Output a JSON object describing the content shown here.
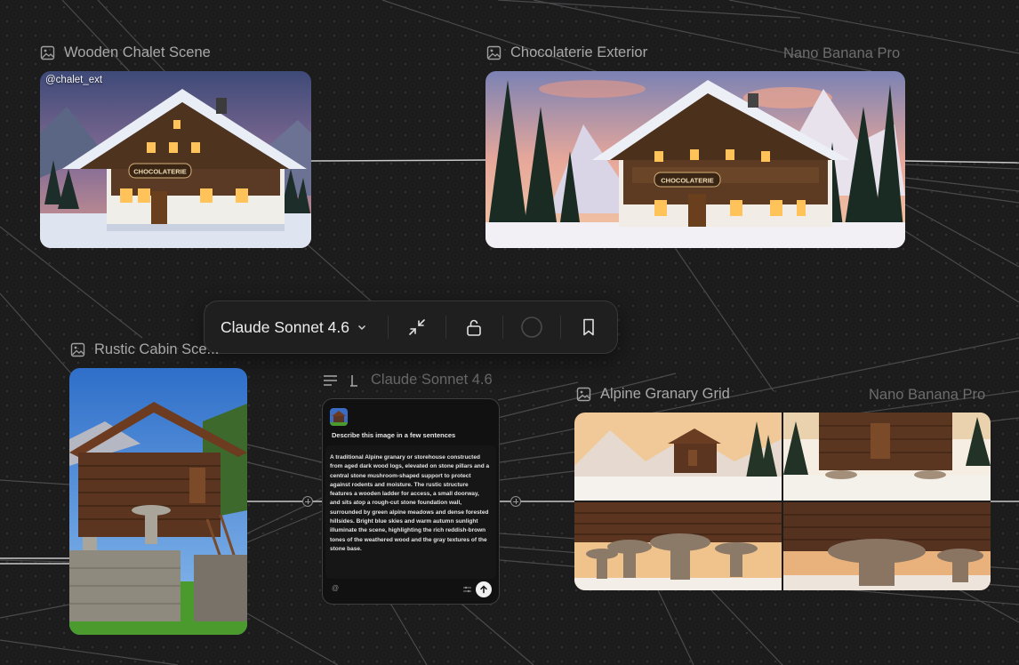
{
  "nodes": {
    "wooden_chalet": {
      "title": "Wooden Chalet Scene",
      "handle": "@chalet_ext"
    },
    "chocolaterie": {
      "title": "Chocolaterie Exterior",
      "model": "Nano Banana Pro"
    },
    "rustic_cabin": {
      "title": "Rustic Cabin Sce..."
    },
    "text_node": {
      "model": "Claude Sonnet 4.6",
      "prompt": "Describe this image in a few sentences",
      "response": "A traditional Alpine granary or storehouse constructed from aged dark wood logs, elevated on stone pillars and a central stone mushroom-shaped support to protect against rodents and moisture. The rustic structure features a wooden ladder for access, a small doorway, and sits atop a rough-cut stone foundation wall, surrounded by green alpine meadows and dense forested hillsides. Bright blue skies and warm autumn sunlight illuminate the scene, highlighting the rich reddish-brown tones of the weathered wood and the gray textures of the stone base.",
      "mention_symbol": "@"
    },
    "alpine_grid": {
      "title": "Alpine Granary Grid",
      "model": "Nano Banana Pro"
    }
  },
  "toolbar": {
    "model_label": "Claude Sonnet 4.6"
  },
  "sign_text": "CHOCOLATERIE",
  "colors": {
    "background": "#1c1c1d",
    "card_border": "#3e3e40",
    "label": "#a8a8a8",
    "muted": "#6d6d6d"
  }
}
